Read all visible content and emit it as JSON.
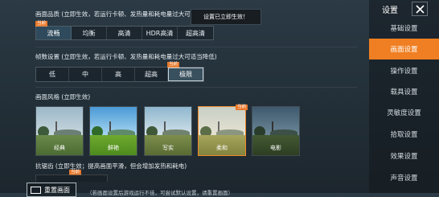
{
  "graphics_quality": {
    "title": "画面品质 (立即生效，若运行卡顿、发热量和耗电量过大可适当",
    "tag": "当前",
    "options": [
      "流畅",
      "均衡",
      "高清",
      "HDR高清",
      "超高清"
    ],
    "selected": "流畅"
  },
  "toast": "设置已立即生效！",
  "frame_rate": {
    "title": "帧数设置 (立即生效，若运行卡顿、发热量和耗电量过大可适当降低)",
    "tag": "当前",
    "options": [
      "低",
      "中",
      "高",
      "超高",
      "极限"
    ],
    "selected": "极限"
  },
  "style": {
    "title": "画面风格 (立即生效)",
    "tag": "当前",
    "options": [
      "经典",
      "鲜艳",
      "写实",
      "柔和",
      "电影"
    ],
    "selected": "柔和"
  },
  "anti_alias": {
    "title": "抗锯齿 (立即生效；提高画面平滑，但会增加发热和耗电)",
    "tag": "当前"
  },
  "footer": {
    "reset_label": "重置画面",
    "note": "（若画面设置后游戏运行不佳，可尝试默认设置，请重置画面）"
  },
  "sidebar": {
    "title": "设置",
    "items": [
      "基础设置",
      "画面设置",
      "操作设置",
      "载具设置",
      "灵敏度设置",
      "拾取设置",
      "效果设置",
      "声音设置"
    ],
    "active": "画面设置"
  },
  "colors": {
    "accent": "#ef7f22",
    "selected_thumb_border": "#f08a2a"
  },
  "icons": {
    "close": "close-icon",
    "reset": "reset-screen-icon"
  }
}
